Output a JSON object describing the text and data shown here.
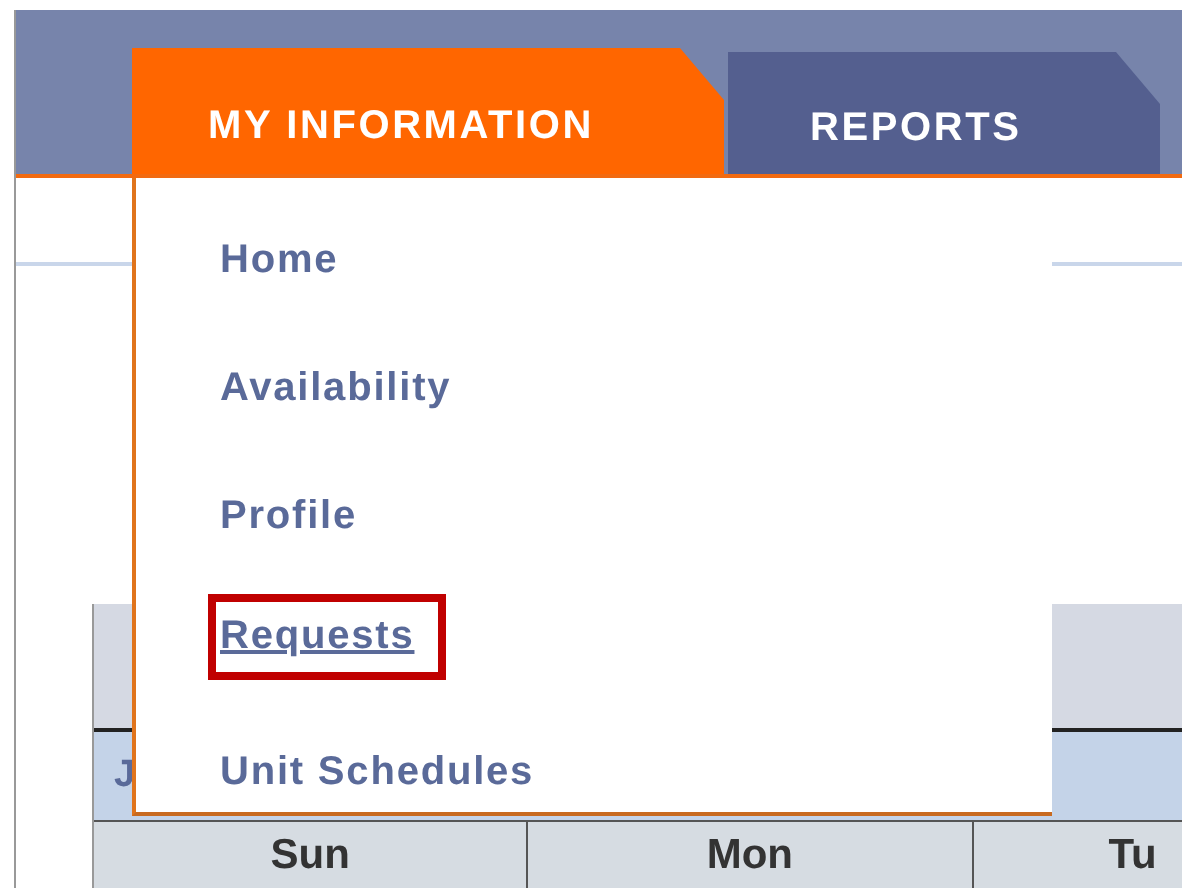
{
  "tabs": [
    {
      "label": "MY INFORMATION",
      "selected": true
    },
    {
      "label": "REPORTS",
      "selected": false
    }
  ],
  "menu": {
    "items": [
      {
        "label": "Home",
        "highlighted": false
      },
      {
        "label": "Availability",
        "highlighted": false
      },
      {
        "label": "Profile",
        "highlighted": false
      },
      {
        "label": "Requests",
        "highlighted": true
      },
      {
        "label": "Unit Schedules",
        "highlighted": false
      }
    ]
  },
  "calendar": {
    "month_label": "J",
    "days": [
      "Sun",
      "Mon",
      "Tu"
    ]
  }
}
